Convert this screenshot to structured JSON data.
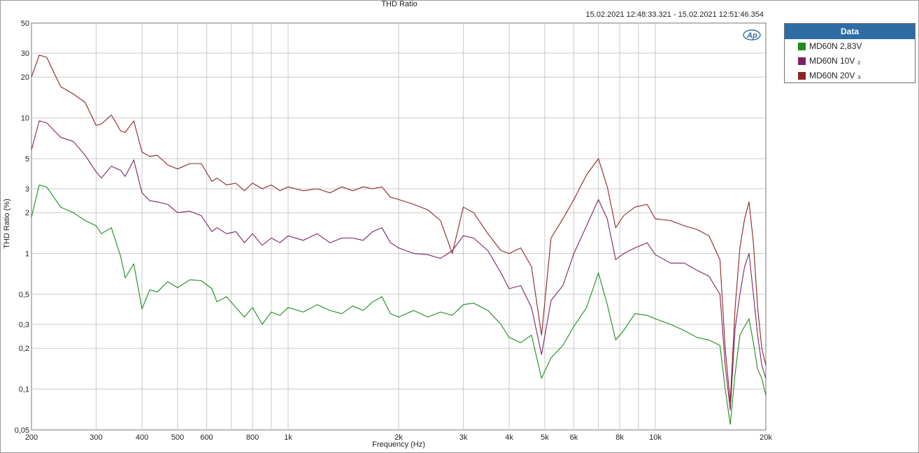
{
  "title": "THD Ratio",
  "timestamp": "15.02.2021 12:48:33.321 - 15.02.2021 12:51:46.354",
  "legend": {
    "header": "Data",
    "items": [
      {
        "label": "MD60N 2,83V",
        "color": "#1c8c1c"
      },
      {
        "label": "MD60N 10V ₂",
        "color": "#7d2363"
      },
      {
        "label": "MD60N 20V ₃",
        "color": "#8c2424"
      }
    ]
  },
  "chart_data": {
    "type": "line",
    "title": "THD Ratio",
    "xlabel": "Frequency (Hz)",
    "ylabel": "THD Ratio (%)",
    "x_scale": "log",
    "y_scale": "log",
    "xlim": [
      200,
      20000
    ],
    "ylim": [
      0.05,
      50
    ],
    "grid": true,
    "legend_position": "right",
    "x_ticks": [
      {
        "v": 200,
        "label": "200"
      },
      {
        "v": 300,
        "label": "300"
      },
      {
        "v": 400,
        "label": "400"
      },
      {
        "v": 500,
        "label": "500"
      },
      {
        "v": 600,
        "label": "600"
      },
      {
        "v": 800,
        "label": "800"
      },
      {
        "v": 1000,
        "label": "1k"
      },
      {
        "v": 2000,
        "label": "2k"
      },
      {
        "v": 3000,
        "label": "3k"
      },
      {
        "v": 4000,
        "label": "4k"
      },
      {
        "v": 5000,
        "label": "5k"
      },
      {
        "v": 6000,
        "label": "6k"
      },
      {
        "v": 8000,
        "label": "8k"
      },
      {
        "v": 10000,
        "label": "10k"
      },
      {
        "v": 20000,
        "label": "20k"
      }
    ],
    "x_minor": [
      700,
      900,
      7000,
      9000
    ],
    "y_ticks": [
      {
        "v": 50,
        "label": "50"
      },
      {
        "v": 30,
        "label": "30"
      },
      {
        "v": 20,
        "label": "20"
      },
      {
        "v": 10,
        "label": "10"
      },
      {
        "v": 5,
        "label": "5"
      },
      {
        "v": 3,
        "label": "3"
      },
      {
        "v": 2,
        "label": "2"
      },
      {
        "v": 1,
        "label": "1"
      },
      {
        "v": 0.5,
        "label": "0,5"
      },
      {
        "v": 0.3,
        "label": "0,3"
      },
      {
        "v": 0.2,
        "label": "0,2"
      },
      {
        "v": 0.1,
        "label": "0,1"
      },
      {
        "v": 0.05,
        "label": "0,05"
      }
    ],
    "series": [
      {
        "name": "MD60N 2,83V",
        "color": "#1c8c1c",
        "points": [
          [
            200,
            1.85
          ],
          [
            210,
            3.2
          ],
          [
            220,
            3.1
          ],
          [
            240,
            2.2
          ],
          [
            260,
            2.0
          ],
          [
            280,
            1.75
          ],
          [
            300,
            1.6
          ],
          [
            310,
            1.4
          ],
          [
            330,
            1.55
          ],
          [
            350,
            0.95
          ],
          [
            360,
            0.66
          ],
          [
            380,
            0.84
          ],
          [
            400,
            0.39
          ],
          [
            420,
            0.54
          ],
          [
            440,
            0.52
          ],
          [
            470,
            0.62
          ],
          [
            500,
            0.56
          ],
          [
            540,
            0.64
          ],
          [
            580,
            0.63
          ],
          [
            620,
            0.55
          ],
          [
            640,
            0.44
          ],
          [
            680,
            0.48
          ],
          [
            720,
            0.4
          ],
          [
            760,
            0.34
          ],
          [
            800,
            0.4
          ],
          [
            850,
            0.3
          ],
          [
            900,
            0.37
          ],
          [
            950,
            0.35
          ],
          [
            1000,
            0.4
          ],
          [
            1100,
            0.37
          ],
          [
            1200,
            0.42
          ],
          [
            1300,
            0.38
          ],
          [
            1400,
            0.36
          ],
          [
            1500,
            0.41
          ],
          [
            1600,
            0.38
          ],
          [
            1700,
            0.44
          ],
          [
            1800,
            0.48
          ],
          [
            1900,
            0.36
          ],
          [
            2000,
            0.34
          ],
          [
            2200,
            0.38
          ],
          [
            2400,
            0.34
          ],
          [
            2600,
            0.37
          ],
          [
            2800,
            0.35
          ],
          [
            3000,
            0.42
          ],
          [
            3200,
            0.43
          ],
          [
            3500,
            0.38
          ],
          [
            3800,
            0.3
          ],
          [
            4000,
            0.24
          ],
          [
            4300,
            0.22
          ],
          [
            4600,
            0.25
          ],
          [
            4900,
            0.12
          ],
          [
            5200,
            0.17
          ],
          [
            5600,
            0.21
          ],
          [
            6000,
            0.29
          ],
          [
            6500,
            0.4
          ],
          [
            7000,
            0.72
          ],
          [
            7400,
            0.42
          ],
          [
            7800,
            0.23
          ],
          [
            8200,
            0.27
          ],
          [
            8800,
            0.36
          ],
          [
            9500,
            0.35
          ],
          [
            10000,
            0.33
          ],
          [
            11000,
            0.3
          ],
          [
            12000,
            0.27
          ],
          [
            13000,
            0.24
          ],
          [
            14000,
            0.23
          ],
          [
            15000,
            0.21
          ],
          [
            15500,
            0.1
          ],
          [
            16000,
            0.055
          ],
          [
            16500,
            0.13
          ],
          [
            17000,
            0.25
          ],
          [
            17500,
            0.29
          ],
          [
            18000,
            0.33
          ],
          [
            18500,
            0.22
          ],
          [
            19000,
            0.14
          ],
          [
            19500,
            0.12
          ],
          [
            20000,
            0.09
          ]
        ]
      },
      {
        "name": "MD60N 10V ₂",
        "color": "#7d2363",
        "points": [
          [
            200,
            5.8
          ],
          [
            210,
            9.5
          ],
          [
            220,
            9.2
          ],
          [
            240,
            7.2
          ],
          [
            260,
            6.7
          ],
          [
            280,
            5.3
          ],
          [
            300,
            4.0
          ],
          [
            310,
            3.6
          ],
          [
            330,
            4.4
          ],
          [
            350,
            4.1
          ],
          [
            360,
            3.7
          ],
          [
            380,
            4.9
          ],
          [
            400,
            2.8
          ],
          [
            420,
            2.45
          ],
          [
            440,
            2.4
          ],
          [
            470,
            2.3
          ],
          [
            500,
            2.0
          ],
          [
            540,
            2.05
          ],
          [
            580,
            1.9
          ],
          [
            620,
            1.45
          ],
          [
            640,
            1.55
          ],
          [
            680,
            1.4
          ],
          [
            720,
            1.45
          ],
          [
            760,
            1.2
          ],
          [
            800,
            1.4
          ],
          [
            850,
            1.15
          ],
          [
            900,
            1.3
          ],
          [
            950,
            1.2
          ],
          [
            1000,
            1.35
          ],
          [
            1100,
            1.25
          ],
          [
            1200,
            1.4
          ],
          [
            1300,
            1.2
          ],
          [
            1400,
            1.3
          ],
          [
            1500,
            1.3
          ],
          [
            1600,
            1.25
          ],
          [
            1700,
            1.45
          ],
          [
            1800,
            1.55
          ],
          [
            1900,
            1.2
          ],
          [
            2000,
            1.1
          ],
          [
            2200,
            1.0
          ],
          [
            2400,
            0.98
          ],
          [
            2600,
            0.92
          ],
          [
            2800,
            1.05
          ],
          [
            3000,
            1.35
          ],
          [
            3200,
            1.3
          ],
          [
            3500,
            1.05
          ],
          [
            3800,
            0.72
          ],
          [
            4000,
            0.55
          ],
          [
            4300,
            0.58
          ],
          [
            4600,
            0.4
          ],
          [
            4900,
            0.18
          ],
          [
            5200,
            0.45
          ],
          [
            5600,
            0.58
          ],
          [
            6000,
            1.0
          ],
          [
            6500,
            1.6
          ],
          [
            7000,
            2.5
          ],
          [
            7400,
            1.8
          ],
          [
            7800,
            0.9
          ],
          [
            8200,
            1.0
          ],
          [
            8800,
            1.1
          ],
          [
            9500,
            1.2
          ],
          [
            10000,
            0.98
          ],
          [
            11000,
            0.85
          ],
          [
            12000,
            0.85
          ],
          [
            13000,
            0.75
          ],
          [
            14000,
            0.68
          ],
          [
            15000,
            0.5
          ],
          [
            15500,
            0.15
          ],
          [
            16000,
            0.07
          ],
          [
            16500,
            0.28
          ],
          [
            17000,
            0.5
          ],
          [
            17500,
            0.8
          ],
          [
            18000,
            1.0
          ],
          [
            18500,
            0.5
          ],
          [
            19000,
            0.25
          ],
          [
            19500,
            0.15
          ],
          [
            20000,
            0.12
          ]
        ]
      },
      {
        "name": "MD60N 20V ₃",
        "color": "#8c2424",
        "points": [
          [
            200,
            20
          ],
          [
            210,
            29
          ],
          [
            220,
            28
          ],
          [
            240,
            17
          ],
          [
            260,
            15
          ],
          [
            280,
            13
          ],
          [
            300,
            8.8
          ],
          [
            310,
            9.0
          ],
          [
            330,
            10.5
          ],
          [
            350,
            8.0
          ],
          [
            360,
            7.8
          ],
          [
            380,
            9.5
          ],
          [
            400,
            5.6
          ],
          [
            420,
            5.2
          ],
          [
            440,
            5.3
          ],
          [
            470,
            4.5
          ],
          [
            500,
            4.2
          ],
          [
            540,
            4.6
          ],
          [
            580,
            4.6
          ],
          [
            620,
            3.4
          ],
          [
            640,
            3.6
          ],
          [
            680,
            3.2
          ],
          [
            720,
            3.3
          ],
          [
            760,
            2.9
          ],
          [
            800,
            3.3
          ],
          [
            850,
            3.0
          ],
          [
            900,
            3.2
          ],
          [
            950,
            2.9
          ],
          [
            1000,
            3.1
          ],
          [
            1100,
            2.9
          ],
          [
            1200,
            3.0
          ],
          [
            1300,
            2.8
          ],
          [
            1400,
            3.1
          ],
          [
            1500,
            2.9
          ],
          [
            1600,
            3.1
          ],
          [
            1700,
            3.0
          ],
          [
            1800,
            3.1
          ],
          [
            1900,
            2.6
          ],
          [
            2000,
            2.5
          ],
          [
            2200,
            2.3
          ],
          [
            2400,
            2.1
          ],
          [
            2600,
            1.75
          ],
          [
            2800,
            1.0
          ],
          [
            3000,
            2.2
          ],
          [
            3200,
            2.0
          ],
          [
            3500,
            1.4
          ],
          [
            3800,
            1.05
          ],
          [
            4000,
            1.0
          ],
          [
            4300,
            1.1
          ],
          [
            4600,
            0.8
          ],
          [
            4900,
            0.25
          ],
          [
            5200,
            1.3
          ],
          [
            5600,
            1.8
          ],
          [
            6000,
            2.5
          ],
          [
            6500,
            3.8
          ],
          [
            7000,
            5.0
          ],
          [
            7400,
            3.1
          ],
          [
            7800,
            1.55
          ],
          [
            8200,
            1.9
          ],
          [
            8800,
            2.2
          ],
          [
            9500,
            2.3
          ],
          [
            10000,
            1.8
          ],
          [
            11000,
            1.75
          ],
          [
            12000,
            1.6
          ],
          [
            13000,
            1.5
          ],
          [
            14000,
            1.35
          ],
          [
            15000,
            0.9
          ],
          [
            15500,
            0.2
          ],
          [
            16000,
            0.08
          ],
          [
            16500,
            0.4
          ],
          [
            17000,
            1.1
          ],
          [
            17500,
            1.8
          ],
          [
            18000,
            2.4
          ],
          [
            18500,
            1.2
          ],
          [
            19000,
            0.4
          ],
          [
            19500,
            0.2
          ],
          [
            20000,
            0.15
          ]
        ]
      }
    ]
  }
}
